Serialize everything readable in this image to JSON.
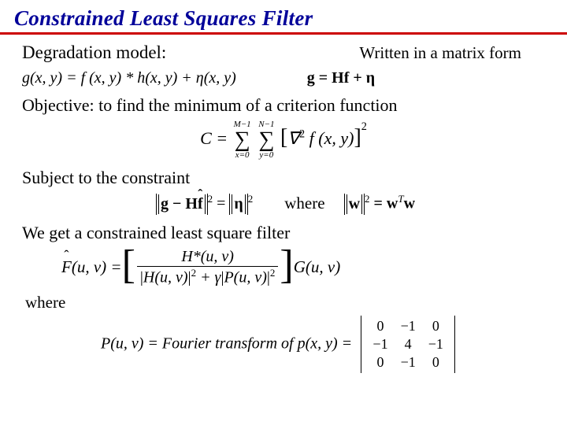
{
  "title": "Constrained Least Squares Filter",
  "row1_left": "Degradation model:",
  "row1_right": "Written in a matrix form",
  "eq_degrade": "g(x, y) = f (x, y) * h(x, y) + η(x, y)",
  "eq_matrix": "g = Hf + η",
  "line_objective": "Objective: to find the minimum of a criterion function",
  "crit": {
    "C_eq": "C =",
    "sum1_top": "M−1",
    "sum1_bot": "x=0",
    "sum2_top": "N−1",
    "sum2_bot": "y=0",
    "body": "∇",
    "body_sup": "2",
    "body_arg": " f (x, y)",
    "outer_sup": "2"
  },
  "line_subject": "Subject to the constraint",
  "constraint_where": "where",
  "normeq_left_inner": "g − H",
  "normeq_left_fhat": "f",
  "normeq_eq_mid": " = ",
  "normeq_right_inner": "η",
  "normeq_sup": "2",
  "wnorm_left": "w",
  "wnorm_eq": " = w",
  "wnorm_T": "T",
  "wnorm_end": "w",
  "line_result": "We get a constrained least square filter",
  "filter": {
    "lhs_F": "F",
    "lhs_args": "(u, v) = ",
    "num": "H*(u, v)",
    "den_h": "H(u, v)",
    "den_plus": " + γ",
    "den_p": "P(u, v)",
    "den_sup": "2",
    "rhs": "G(u, v)"
  },
  "where2": "where",
  "fourier_line_pre": "P(u, v) = Fourier transform of p(x, y) =",
  "matrix": [
    [
      "0",
      "−1",
      "0"
    ],
    [
      "−1",
      "4",
      "−1"
    ],
    [
      "0",
      "−1",
      "0"
    ]
  ]
}
